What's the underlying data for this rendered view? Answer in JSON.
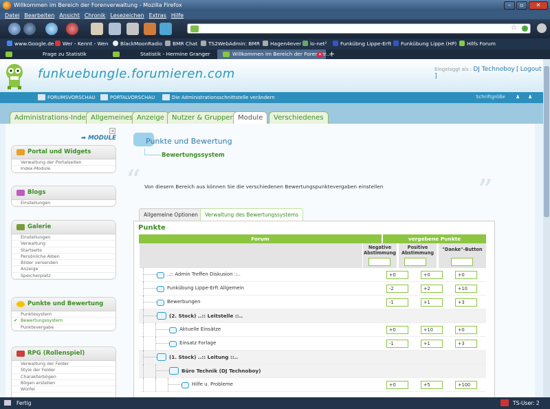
{
  "window": {
    "title": "Willkommen im Bereich der Forenverwaltung - Mozilla Firefox",
    "min": "–",
    "max": "▫",
    "close": "✕"
  },
  "menu": [
    "Datei",
    "Bearbeiten",
    "Ansicht",
    "Chronik",
    "Lesezeichen",
    "Extras",
    "Hilfe"
  ],
  "bookmarks": [
    "www.Google.de",
    "Wer - Kennt - Wen",
    "BlackMoonRadio",
    "BMR Chat",
    "TS2WebAdmin: BMR",
    "Hagen4ever",
    "lo-net²",
    "Funkübng Lippe-Erft",
    "Funkübung Lippe (HP)",
    "Hilfs Forum"
  ],
  "browser_tabs": [
    {
      "label": "Frage zu Statistik",
      "active": false
    },
    {
      "label": "Statistik - Hermine Granger",
      "active": false
    },
    {
      "label": "Willkommen im Bereich der Forenver...",
      "active": true
    }
  ],
  "header": {
    "site_title": "funkuebungle.forumieren.com",
    "logged_prefix": "Eingeloggt als :",
    "user": "DJ Technoboy",
    "logout": "Logout"
  },
  "toolbar": {
    "forum_preview": "FORUMSVORSCHAU",
    "portal_preview": "PORTALVORSCHAU",
    "change_admin": "Die Administrationsschnittstelle verändern",
    "font_size": "Schriftgröße"
  },
  "module_tabs": [
    {
      "label": "Administrations-Index",
      "active": false
    },
    {
      "label": "Allgemeines",
      "active": false
    },
    {
      "label": "Anzeige",
      "active": false
    },
    {
      "label": "Nutzer & Gruppen",
      "active": false
    },
    {
      "label": "Module",
      "active": true
    },
    {
      "label": "Verschiedenes",
      "active": false
    }
  ],
  "sidebar": {
    "collapse": "◂",
    "module_label": "➡ MODULE",
    "sections": [
      {
        "title": "Portal und Widgets",
        "icon_color": "#e8a024",
        "items": [
          {
            "label": "Verwaltung der Portalseiten",
            "active": false
          },
          {
            "label": "Index-Module",
            "active": false
          }
        ]
      },
      {
        "title": "Blogs",
        "icon_color": "#c05bc0",
        "items": [
          {
            "label": "Einstellungen",
            "active": false
          }
        ]
      },
      {
        "title": "Galerie",
        "icon_color": "#7a9a3a",
        "items": [
          {
            "label": "Einstellungen",
            "active": false
          },
          {
            "label": "Verwaltung",
            "active": false
          },
          {
            "label": "Startseite",
            "active": false
          },
          {
            "label": "Persönliche Alben",
            "active": false
          },
          {
            "label": "Bilder versenden",
            "active": false
          },
          {
            "label": "Anzeige",
            "active": false
          },
          {
            "label": "Speicherplatz",
            "active": false
          }
        ]
      },
      {
        "title": "Punkte und Bewertung",
        "icon_color": "#f5c400",
        "items": [
          {
            "label": "Punktesystem",
            "active": false
          },
          {
            "label": "Bewertungssystem",
            "active": true
          },
          {
            "label": "Punktevergabe",
            "active": false
          }
        ]
      },
      {
        "title": "RPG (Rollenspiel)",
        "icon_color": "#c8403a",
        "items": [
          {
            "label": "Verwaltung der Felder",
            "active": false
          },
          {
            "label": "Style der Felder",
            "active": false
          },
          {
            "label": "Charakterbögen",
            "active": false
          },
          {
            "label": "Bögen erstellen",
            "active": false
          },
          {
            "label": "Würfel",
            "active": false
          }
        ]
      }
    ]
  },
  "main": {
    "title": "Punkte und Bewertung",
    "subtitle": "Bewertungssystem",
    "description": "Von diesem Bereich aus können Sie die verschiedenen Bewertungspunktevergaben einstellen",
    "tabs": [
      {
        "label": "Allgemeine Optionen",
        "active": false
      },
      {
        "label": "Verwaltung des Bewertungssystems",
        "active": true
      }
    ],
    "section_title": "Punkte",
    "table": {
      "header_forum": "Forum",
      "header_points": "vergebene Punkte",
      "col_negative": "Negative Abstimmung",
      "col_positive": "Positive Abstimmung",
      "col_thanks": "\"Danke\"-Button",
      "rows": [
        {
          "name": "..:: Admin Treffen Diskusion ::..",
          "category": false,
          "level": 1,
          "neg": "+0",
          "pos": "+0",
          "thx": "+0"
        },
        {
          "name": "Funkübung Lippe-Erft Allgemein",
          "category": false,
          "level": 1,
          "neg": "-2",
          "pos": "+2",
          "thx": "+10"
        },
        {
          "name": "Bewerbungen",
          "category": false,
          "level": 1,
          "neg": "-1",
          "pos": "+1",
          "thx": "+3"
        },
        {
          "name": "(2. Stock) ..:: Leitstelle ::..",
          "category": true,
          "level": 1,
          "neg": "",
          "pos": "",
          "thx": ""
        },
        {
          "name": "Aktuelle Einsätze",
          "category": false,
          "level": 2,
          "neg": "+0",
          "pos": "+10",
          "thx": "+0"
        },
        {
          "name": "Einsatz Forlage",
          "category": false,
          "level": 2,
          "neg": "-1",
          "pos": "+1",
          "thx": "+3"
        },
        {
          "name": "(1. Stock) ..:: Leitung ::..",
          "category": true,
          "level": 1,
          "neg": "",
          "pos": "",
          "thx": ""
        },
        {
          "name": "Büro Technik (DJ Technoboy)",
          "category": true,
          "level": 2,
          "neg": "",
          "pos": "",
          "thx": ""
        },
        {
          "name": "Hilfe u. Probleme",
          "category": false,
          "level": 3,
          "neg": "+0",
          "pos": "+5",
          "thx": "+100"
        }
      ]
    }
  },
  "status": {
    "text": "Fertig",
    "ts_user": "TS-User: 2"
  },
  "colors": {
    "accent_green": "#8cc540",
    "link_blue": "#2e7ba8",
    "toolbar_blue": "#2c8fbd"
  }
}
